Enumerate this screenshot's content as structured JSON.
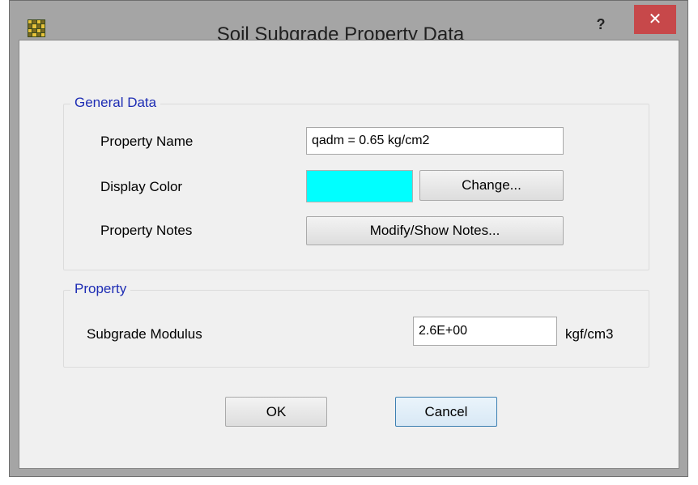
{
  "window": {
    "title": "Soil Subgrade Property Data",
    "help_label": "?",
    "close_label": "✕"
  },
  "general_data": {
    "title": "General Data",
    "property_name_label": "Property Name",
    "property_name_value": "qadm = 0.65 kg/cm2",
    "display_color_label": "Display Color",
    "display_color": "#00ffff",
    "change_button": "Change...",
    "property_notes_label": "Property Notes",
    "notes_button": "Modify/Show Notes..."
  },
  "property": {
    "title": "Property",
    "subgrade_modulus_label": "Subgrade Modulus",
    "subgrade_modulus_value": "2.6E+00",
    "unit": "kgf/cm3"
  },
  "buttons": {
    "ok": "OK",
    "cancel": "Cancel"
  },
  "icons": {
    "app": "grid-app-icon",
    "help": "help-icon",
    "close": "close-icon"
  },
  "colors": {
    "close_button": "#c7484a",
    "group_title": "#1e2db4",
    "focus_border": "#3c7fb1"
  }
}
